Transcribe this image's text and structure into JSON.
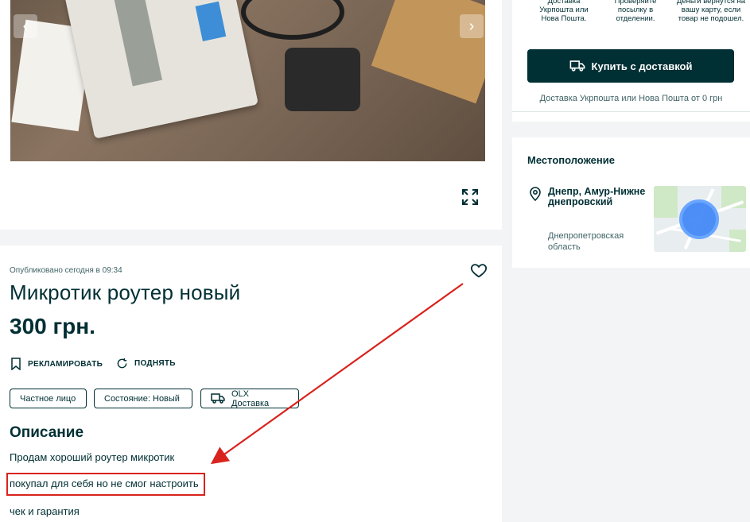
{
  "gallery": {
    "prev_arrow": "‹",
    "next_arrow": "›"
  },
  "ad": {
    "published": "Опубликовано сегодня в 09:34",
    "title": "Микротик роутер новый",
    "price": "300 грн.",
    "actions": {
      "promote": "РЕКЛАМИРОВАТЬ",
      "raise": "ПОДНЯТЬ"
    },
    "tags": [
      "Частное лицо",
      "Состояние: Новый",
      "OLX Доставка"
    ],
    "description_heading": "Описание",
    "description_lines": [
      "Продам хороший роутер микротик",
      "покупал для себя но не смог настроить",
      "чек и гарантия"
    ]
  },
  "delivery": {
    "steps": [
      "Доставка Укрпошта или Нова Пошта.",
      "Проверяйте посылку в отделении.",
      "Деньги вернутся на вашу карту, если товар не подошел."
    ],
    "buy_button": "Купить с доставкой",
    "note": "Доставка Укрпошта или Нова Пошта от 0 грн"
  },
  "location": {
    "heading": "Местоположение",
    "city": "Днепр, Амур-Нижнеднепровский",
    "region": "Днепропетровская область"
  },
  "colors": {
    "primary": "#002f34",
    "annotation": "#d9231d",
    "map_marker": "#3b82f6"
  }
}
